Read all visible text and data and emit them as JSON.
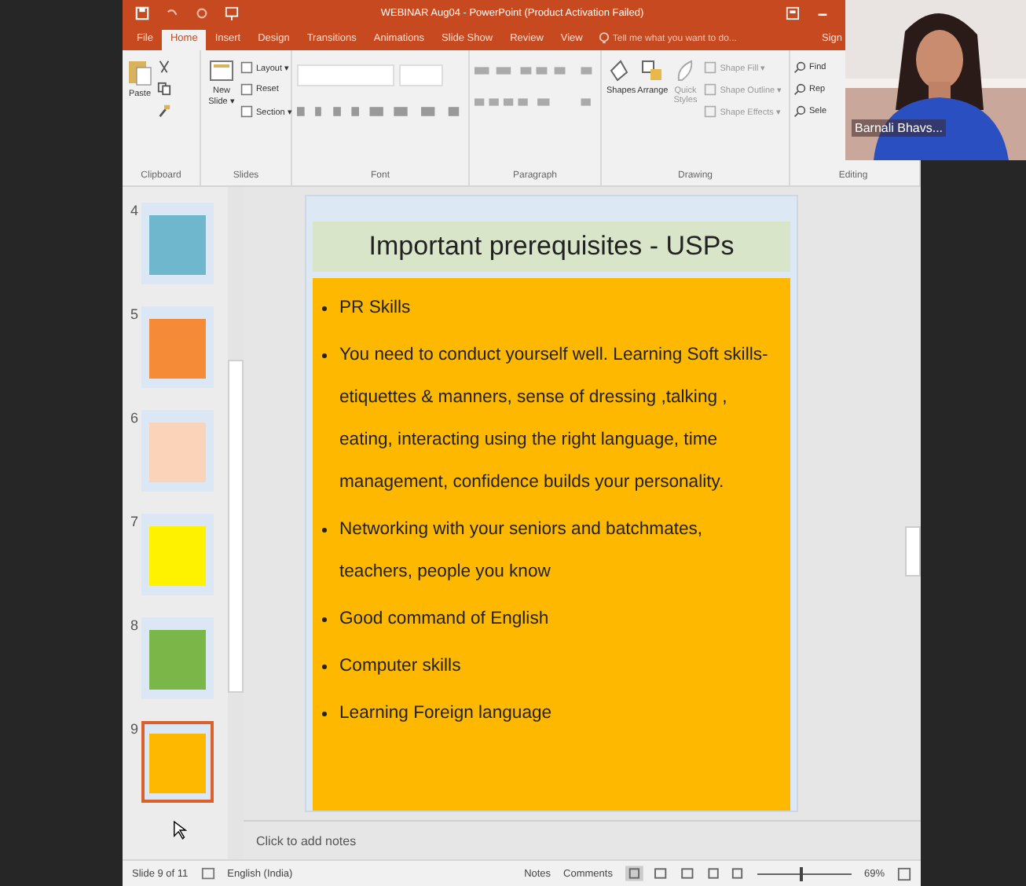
{
  "window": {
    "title": "WEBINAR Aug04 - PowerPoint (Product Activation Failed)"
  },
  "tabs": [
    {
      "label": "File",
      "selected": false
    },
    {
      "label": "Home",
      "selected": true
    },
    {
      "label": "Insert",
      "selected": false
    },
    {
      "label": "Design",
      "selected": false
    },
    {
      "label": "Transitions",
      "selected": false
    },
    {
      "label": "Animations",
      "selected": false
    },
    {
      "label": "Slide Show",
      "selected": false
    },
    {
      "label": "Review",
      "selected": false
    },
    {
      "label": "View",
      "selected": false
    }
  ],
  "tell_me": {
    "placeholder": "Tell me what you want to do..."
  },
  "sign_in": "Sign",
  "ribbon": {
    "groups": [
      {
        "label": "Clipboard",
        "buttons": [
          "Paste"
        ]
      },
      {
        "label": "Slides",
        "buttons": [
          "New Slide ▾",
          "Layout ▾",
          "Reset",
          "Section ▾"
        ]
      },
      {
        "label": "Font"
      },
      {
        "label": "Paragraph"
      },
      {
        "label": "Drawing",
        "buttons": [
          "Shapes",
          "Arrange",
          "Quick Styles",
          "Shape Fill ▾",
          "Shape Outline ▾",
          "Shape Effects ▾"
        ]
      },
      {
        "label": "Editing",
        "buttons": [
          "Find",
          "Rep",
          "Sele"
        ]
      }
    ]
  },
  "thumbnails": [
    {
      "number": "4",
      "color": "#6fb7cc",
      "selected": false
    },
    {
      "number": "5",
      "color": "#f68b37",
      "selected": false
    },
    {
      "number": "6",
      "color": "#fbd3b8",
      "selected": false
    },
    {
      "number": "7",
      "color": "#fff200",
      "selected": false
    },
    {
      "number": "8",
      "color": "#7ab648",
      "selected": false
    },
    {
      "number": "9",
      "color": "#ffb800",
      "selected": true
    }
  ],
  "slide": {
    "title": "Important prerequisites - USPs",
    "bullets": [
      "PR Skills",
      "You need to conduct yourself well. Learning Soft skills- etiquettes & manners, sense of dressing ,talking , eating, interacting using the right language, time management, confidence builds your personality.",
      "Networking with your seniors and batchmates, teachers, people you know",
      "Good command of English",
      "Computer skills",
      "Learning Foreign language"
    ]
  },
  "notes": {
    "placeholder": "Click to add notes"
  },
  "status_bar": {
    "slide": "Slide 9 of 11",
    "language": "English (India)",
    "notes": "Notes",
    "comments": "Comments",
    "zoom": "69%",
    "level": 0.45
  },
  "video": {
    "name": "Barnali Bhavs..."
  }
}
